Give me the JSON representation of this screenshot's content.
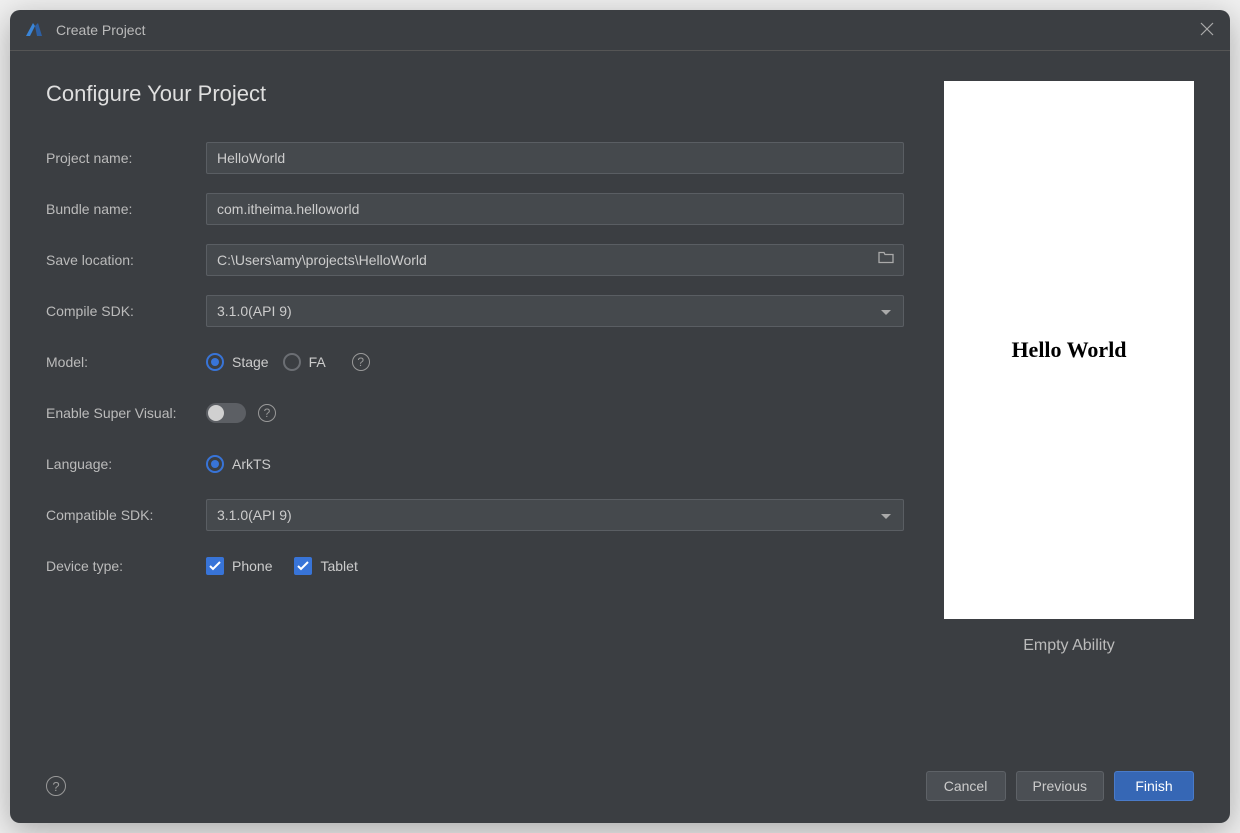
{
  "titlebar": {
    "title": "Create Project"
  },
  "heading": "Configure Your Project",
  "fields": {
    "projectName": {
      "label": "Project name:",
      "value": "HelloWorld"
    },
    "bundleName": {
      "label": "Bundle name:",
      "value": "com.itheima.helloworld"
    },
    "saveLocation": {
      "label": "Save location:",
      "value": "C:\\Users\\amy\\projects\\HelloWorld"
    },
    "compileSdk": {
      "label": "Compile SDK:",
      "value": "3.1.0(API 9)"
    },
    "model": {
      "label": "Model:",
      "option1": "Stage",
      "option2": "FA"
    },
    "enableSuperVisual": {
      "label": "Enable Super Visual:"
    },
    "language": {
      "label": "Language:",
      "option1": "ArkTS"
    },
    "compatibleSdk": {
      "label": "Compatible SDK:",
      "value": "3.1.0(API 9)"
    },
    "deviceType": {
      "label": "Device type:",
      "option1": "Phone",
      "option2": "Tablet"
    }
  },
  "preview": {
    "text": "Hello World",
    "caption": "Empty Ability"
  },
  "footer": {
    "cancel": "Cancel",
    "previous": "Previous",
    "finish": "Finish"
  }
}
